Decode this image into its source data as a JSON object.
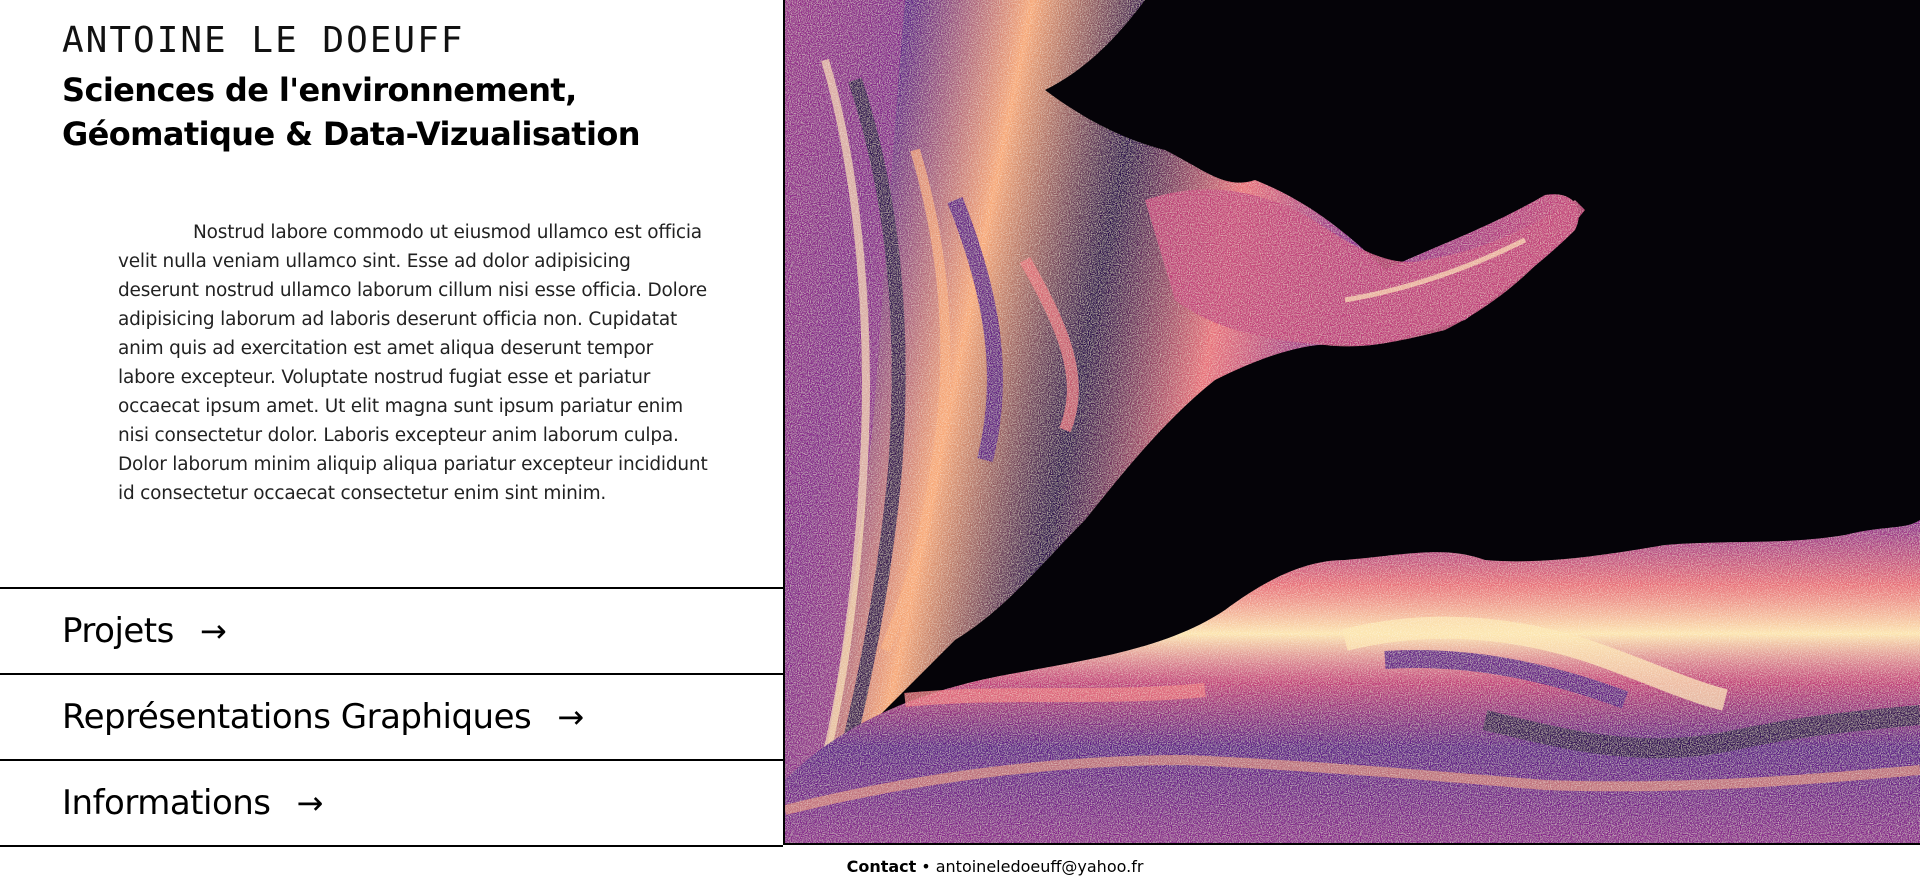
{
  "header": {
    "name": "ANTOINE LE DOEUFF",
    "subtitle_line1": "Sciences de l'environnement,",
    "subtitle_line2": "Géomatique & Data-Vizualisation"
  },
  "intro": {
    "text": "Nostrud labore commodo ut eiusmod ullamco est officia velit nulla veniam ullamco sint. Esse ad dolor adipisicing deserunt nostrud ullamco laborum cillum nisi esse officia. Dolore adipisicing laborum ad laboris deserunt officia non. Cupidatat anim quis ad exercitation est amet aliqua deserunt tempor labore excepteur. Voluptate nostrud fugiat esse et pariatur occaecat ipsum amet. Ut elit magna sunt ipsum pariatur enim nisi consectetur dolor. Laboris excepteur anim laborum culpa. Dolor laborum minim aliquip aliqua pariatur excepteur incididunt id consectetur occaecat consectetur enim sint minim."
  },
  "nav": {
    "items": [
      {
        "label": "Projets",
        "arrow": "→"
      },
      {
        "label": "Représentations Graphiques",
        "arrow": "→"
      },
      {
        "label": "Informations",
        "arrow": "→"
      }
    ]
  },
  "hero": {
    "icon": "magma-relief-map-image",
    "colors": [
      "#050308",
      "#2a0f4d",
      "#5b1a86",
      "#8c2a8c",
      "#c2407a",
      "#e8707a",
      "#f7a877",
      "#fce5b0"
    ]
  },
  "footer": {
    "contact_label": "Contact",
    "separator": "•",
    "email": "antoineledoeuff@yahoo.fr"
  }
}
